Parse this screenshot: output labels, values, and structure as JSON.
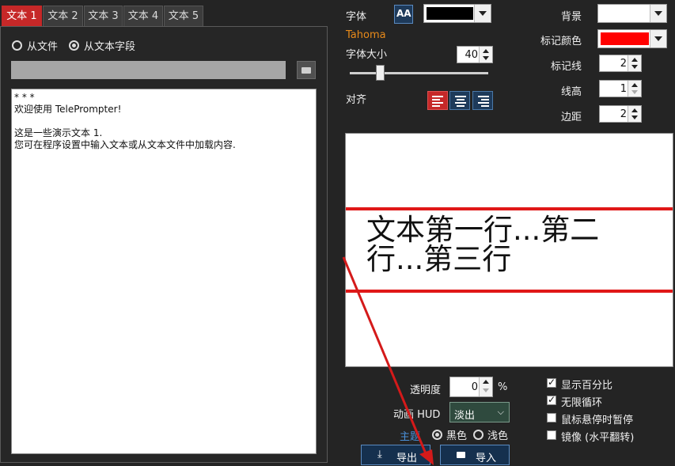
{
  "tabs": [
    "文本 1",
    "文本 2",
    "文本 3",
    "文本 4",
    "文本 5"
  ],
  "source": {
    "from_file": "从文件",
    "from_text": "从文本字段",
    "selected": "from_text"
  },
  "text_content": "* * *\n欢迎使用 TelePrompter!\n\n这是一些演示文本 1.\n您可在程序设置中输入文本或从文本文件中加载内容.",
  "font": {
    "label": "字体",
    "name": "Tahoma",
    "color": "#000000",
    "size_label": "字体大小",
    "size_value": "40",
    "slider_level": 0.22
  },
  "align": {
    "label": "对齐",
    "selected": "left"
  },
  "right_settings": {
    "background_label": "背景",
    "background_color": "#ffffff",
    "marker_color_label": "标记颜色",
    "marker_color": "#ff0000",
    "marker_line_label": "标记线",
    "marker_line_value": "2",
    "line_height_label": "线高",
    "line_height_value": "1",
    "margin_label": "边距",
    "margin_value": "2"
  },
  "preview": {
    "text": "文本第一行...第二行...第三行"
  },
  "opacity": {
    "label": "透明度",
    "value": "0",
    "unit": "%"
  },
  "hud": {
    "label": "动画 HUD",
    "value": "淡出"
  },
  "theme": {
    "label": "主题",
    "dark": "黑色",
    "light": "浅色",
    "selected": "dark"
  },
  "checks": [
    {
      "label": "显示百分比",
      "checked": true
    },
    {
      "label": "无限循环",
      "checked": true
    },
    {
      "label": "鼠标悬停时暂停",
      "checked": false
    },
    {
      "label": "镜像 (水平翻转)",
      "checked": false
    }
  ],
  "buttons": {
    "export": "导出",
    "import": "导入"
  },
  "colors": {
    "accent": "#c62828",
    "marker": "#e01818",
    "button_blue": "#15304e"
  }
}
